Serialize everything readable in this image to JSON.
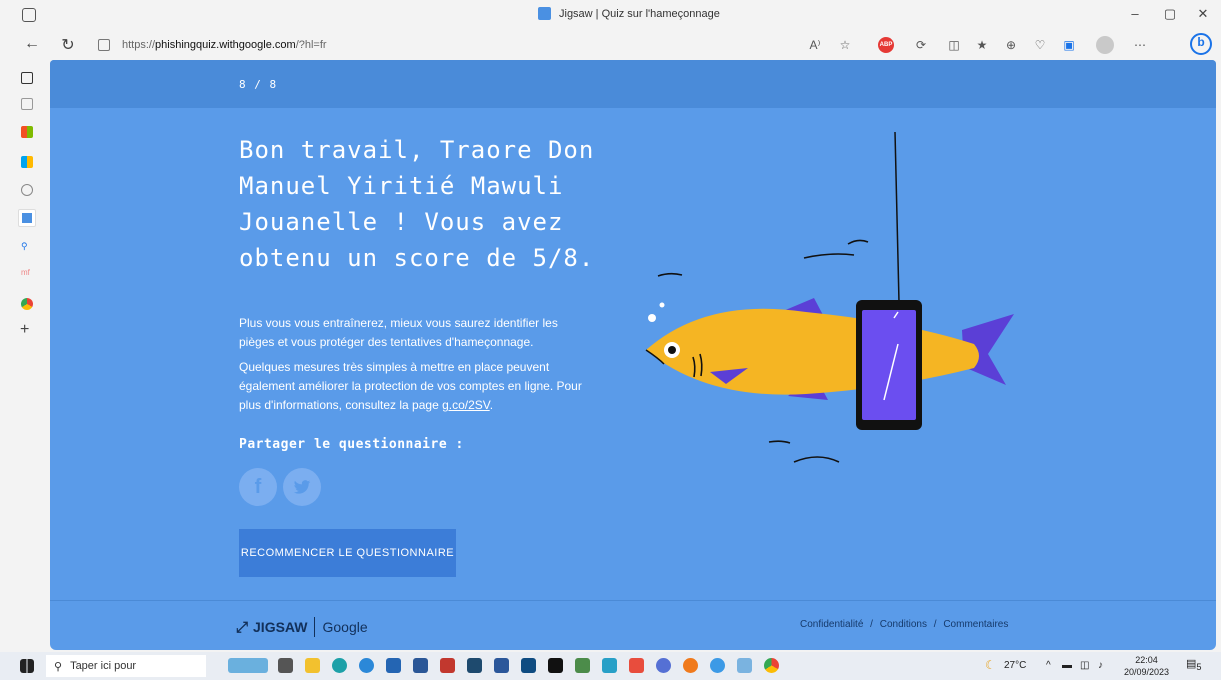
{
  "browser": {
    "tab_title": "Jigsaw | Quiz sur l'hameçonnage",
    "url_prefix": "https://",
    "url_host": "phishingquiz.withgoogle.com",
    "url_path": "/?hl=fr",
    "read_aloud": "A⁾",
    "more": "⋯",
    "window_controls": {
      "minimize": "–",
      "restore": "▢",
      "close": "✕"
    }
  },
  "page": {
    "progress": "8 / 8",
    "headline": "Bon travail, Traore Don Manuel Yiritié Mawuli Jouanelle ! Vous avez obtenu un score de 5/8.",
    "para1": "Plus vous vous entraînerez, mieux vous saurez identifier les pièges et vous protéger des tentatives d'hameçonnage.",
    "para2_text": "Quelques mesures très simples à mettre en place peuvent également améliorer la protection de vos comptes en ligne. Pour plus d'informations, consultez la page ",
    "para2_link": "g.co/2SV",
    "para2_end": ".",
    "share_title": "Partager le questionnaire :",
    "facebook_glyph": "f",
    "twitter_glyph": "ᵗ",
    "restart_button": "RECOMMENCER LE QUESTIONNAIRE",
    "footer": {
      "jigsaw": "JIGSAW",
      "google": "Google",
      "links": [
        "Confidentialité",
        "Conditions",
        "Commentaires"
      ],
      "separator": "/"
    }
  },
  "taskbar": {
    "search_placeholder": "Taper ici pour",
    "weather": "27°C",
    "time": "22:04",
    "date": "20/09/2023",
    "notification_count": "5"
  },
  "colors": {
    "page_bg": "#5a9be9",
    "top_band": "#4a8bd9",
    "button": "#3c7dd8",
    "fish": "#f5b523",
    "fin": "#5b3fd6",
    "phone_screen": "#6b4ef0"
  },
  "icons": {
    "share": [
      "facebook-icon",
      "twitter-icon"
    ],
    "sidebar": [
      "tabs-icon",
      "document-icon",
      "office-icon",
      "apps-icon",
      "shield-icon",
      "active-tab-icon",
      "search-icon",
      "mf-icon",
      "chrome-icon",
      "plus-icon"
    ]
  }
}
